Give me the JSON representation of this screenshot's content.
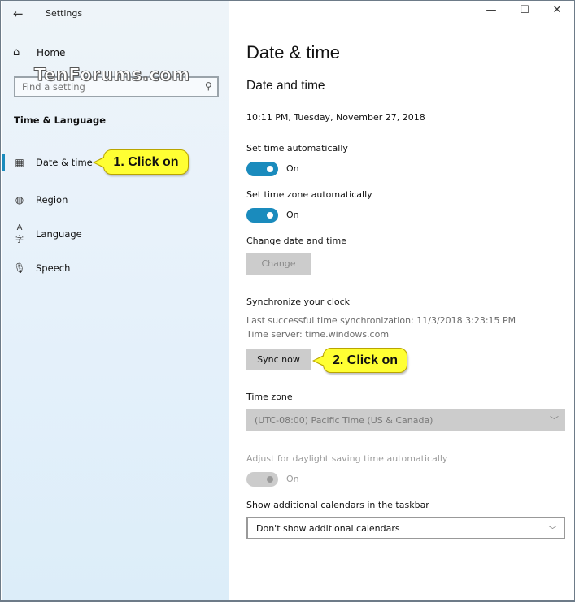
{
  "window": {
    "app_title": "Settings",
    "controls": {
      "minimize": "—",
      "maximize": "☐",
      "close": "✕"
    }
  },
  "watermark": "TenForums.com",
  "sidebar": {
    "home_label": "Home",
    "search_placeholder": "Find a setting",
    "section_header": "Time & Language",
    "items": [
      {
        "label": "Date & time",
        "icon": "calendar-clock-icon",
        "selected": true
      },
      {
        "label": "Region",
        "icon": "globe-icon",
        "selected": false
      },
      {
        "label": "Language",
        "icon": "language-icon",
        "selected": false
      },
      {
        "label": "Speech",
        "icon": "microphone-icon",
        "selected": false
      }
    ]
  },
  "callouts": {
    "first": "1. Click on",
    "second": "2. Click on"
  },
  "main": {
    "page_title": "Date & time",
    "section_title": "Date and time",
    "current_datetime": "10:11 PM, Tuesday, November 27, 2018",
    "set_time_auto": {
      "label": "Set time automatically",
      "state": "On",
      "on": true
    },
    "set_tz_auto": {
      "label": "Set time zone automatically",
      "state": "On",
      "on": true
    },
    "change_dt": {
      "label": "Change date and time",
      "button": "Change",
      "enabled": false
    },
    "sync": {
      "label": "Synchronize your clock",
      "last_sync": "Last successful time synchronization: 11/3/2018 3:23:15 PM",
      "server": "Time server: time.windows.com",
      "button": "Sync now"
    },
    "time_zone": {
      "label": "Time zone",
      "value": "(UTC-08:00) Pacific Time (US & Canada)",
      "enabled": false
    },
    "dst": {
      "label": "Adjust for daylight saving time automatically",
      "state": "On",
      "enabled": false
    },
    "calendars": {
      "label": "Show additional calendars in the taskbar",
      "value": "Don't show additional calendars"
    }
  },
  "colors": {
    "accent": "#1a8bbd",
    "callout": "#ffff33",
    "disabled_bg": "#cccccc"
  }
}
